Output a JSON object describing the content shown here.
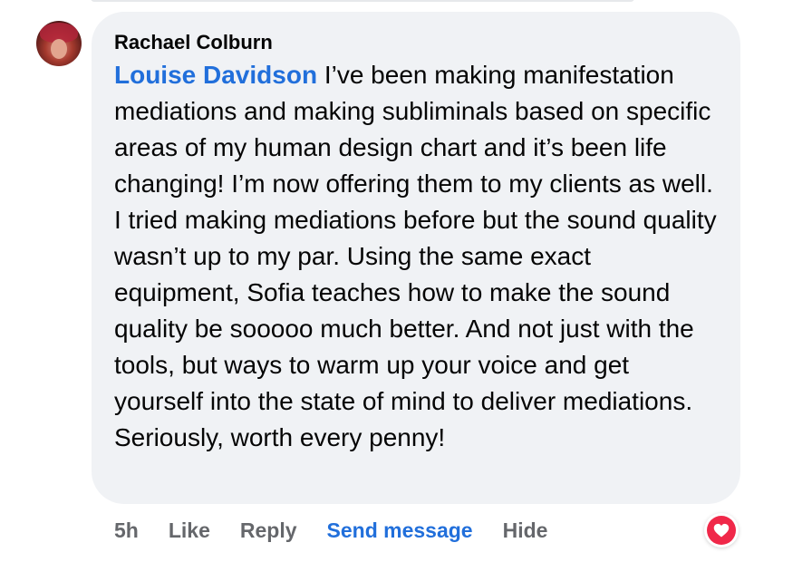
{
  "comment": {
    "author": "Rachael Colburn",
    "mention": "Louise Davidson",
    "text": " I’ve been making manifestation mediations and making subliminals based on specific areas of my human design chart and it’s been life changing! I’m now offering them to my clients as well. I tried making mediations before but the sound quality wasn’t up to my par. Using the same exact equipment, Sofia teaches how to make the sound quality be sooooo much better. And not just with the tools, but ways to warm up your voice and get yourself into the state of mind to deliver mediations. Seriously, worth every penny!"
  },
  "actions": {
    "timestamp": "5h",
    "like": "Like",
    "reply": "Reply",
    "send_message": "Send message",
    "hide": "Hide"
  },
  "reaction": {
    "icon": "heart-icon",
    "color": "#f02849"
  },
  "colors": {
    "bubble": "#f0f2f5",
    "link": "#216fdb",
    "muted": "#65676b",
    "text": "#050505"
  }
}
